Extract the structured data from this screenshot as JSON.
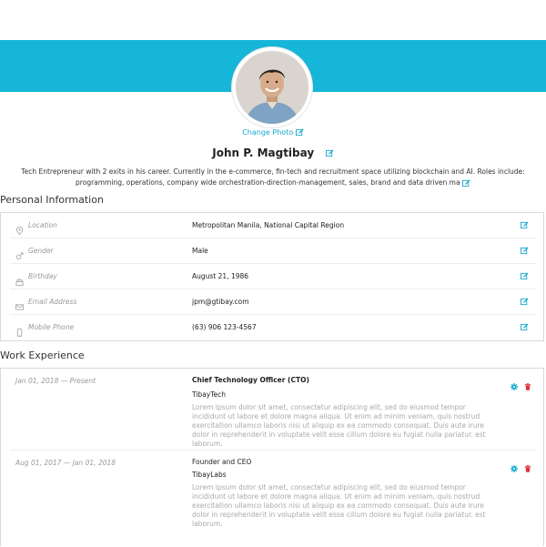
{
  "profile": {
    "change_photo": "Change Photo",
    "name": "John P. Magtibay",
    "bio": "Tech Entrepreneur with 2 exits in his career. Currently in the e-commerce, fin-tech and recruitment space utilizing blockchain and AI. Roles include: programming, operations, company wide orchestration-direction-management, sales, brand and data driven ma"
  },
  "personal": {
    "section_title": "Personal Information",
    "rows": [
      {
        "icon": "location-pin-icon",
        "label": "Location",
        "value": "Metropolitan Manila, National Capital Region"
      },
      {
        "icon": "gender-icon",
        "label": "Gender",
        "value": "Male"
      },
      {
        "icon": "birthday-cake-icon",
        "label": "Birthday",
        "value": "August 21, 1986"
      },
      {
        "icon": "envelope-icon",
        "label": "Email Address",
        "value": "jpm@gtibay.com"
      },
      {
        "icon": "mobile-phone-icon",
        "label": "Mobile Phone",
        "value": "(63) 906 123-4567"
      }
    ]
  },
  "work": {
    "section_title": "Work Experience",
    "jobs": [
      {
        "dates": "Jan 01, 2018 — Present",
        "title": "Chief Technology Officer (CTO)",
        "company": "TibayTech",
        "description": "Lorem ipsum dolor sit amet, consectetur adipiscing elit, sed do eiusmod tempor incididunt ut labore et dolore magna aliqua. Ut enim ad minim veniam, quis nostrud exercitation ullamco laboris nisi ut aliquip ex ea commodo consequat. Duis aute irure dolor in reprehenderit in voluptate velit esse cillum dolore eu fugiat nulla pariatur. est laborum."
      },
      {
        "dates": "Aug 01, 2017 — Jan 01, 2018",
        "title": "Founder and CEO",
        "company": "TibayLabs",
        "description": "Lorem ipsum dolor sit amet, consectetur adipiscing elit, sed do eiusmod tempor incididunt ut labore et dolore magna aliqua. Ut enim ad minim veniam, quis nostrud exercitation ullamco laboris nisi ut aliquip ex ea commodo consequat. Duis aute irure dolor in reprehenderit in voluptate velit esse cillum dolore eu fugiat nulla pariatur. est laborum."
      }
    ]
  },
  "colors": {
    "accent": "#15b6d8",
    "edit_icon": "#15a9cf",
    "delete_icon": "#e0313a"
  }
}
